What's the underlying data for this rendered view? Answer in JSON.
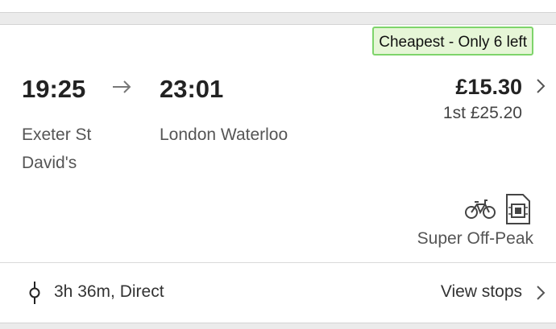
{
  "journey": {
    "badge": "Cheapest - Only 6 left",
    "departure_time": "19:25",
    "arrival_time": "23:01",
    "departure_station": "Exeter St David's",
    "arrival_station": "London Waterloo",
    "price": "£15.30",
    "first_class_price": "1st £25.20",
    "ticket_type": "Super Off-Peak",
    "summary": "3h 36m, Direct",
    "view_stops_label": "View stops",
    "icons": {
      "arrow": "arrow-right-icon",
      "bike": "bicycle-icon",
      "smartcard": "smartcard-icon",
      "route": "route-icon",
      "chevron": "chevron-right-icon"
    }
  },
  "colors": {
    "badge_bg": "#e6f6d7",
    "badge_border": "#7ed46b",
    "page_bg": "#ebebeb",
    "card_bg": "#ffffff"
  }
}
